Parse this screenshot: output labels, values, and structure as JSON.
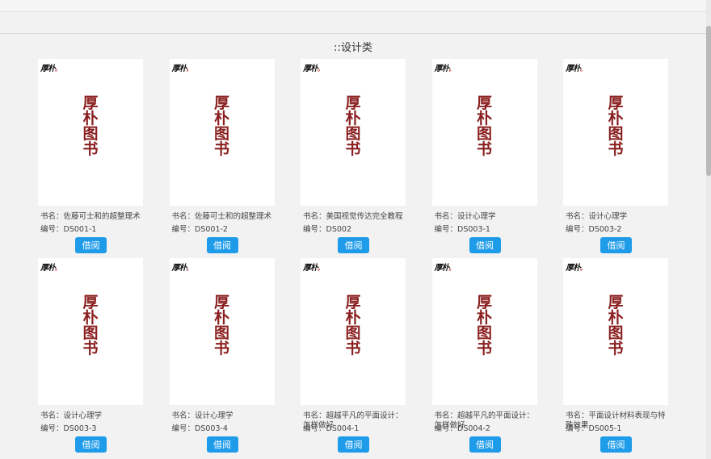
{
  "category": {
    "title": "::设计类"
  },
  "cover": {
    "logo": "厚朴",
    "logo_dot": "。",
    "title": "厚朴图书"
  },
  "labels": {
    "name_prefix": "书名：",
    "id_prefix": "编号：",
    "borrow": "借阅"
  },
  "books": [
    {
      "name": "佐藤可士和的超整理术",
      "id": "DS001-1"
    },
    {
      "name": "佐藤可士和的超整理术",
      "id": "DS001-2"
    },
    {
      "name": "美国视觉传达完全教程",
      "id": "DS002"
    },
    {
      "name": "设计心理学",
      "id": "DS003-1"
    },
    {
      "name": "设计心理学",
      "id": "DS003-2"
    },
    {
      "name": "设计心理学",
      "id": "DS003-3"
    },
    {
      "name": "设计心理学",
      "id": "DS003-4"
    },
    {
      "name": "超越平凡的平面设计：怎样做好",
      "id": "DS004-1"
    },
    {
      "name": "超越平凡的平面设计：怎样做好",
      "id": "DS004-2"
    },
    {
      "name": "平面设计材料表现与特殊效果",
      "id": "DS005-1"
    }
  ]
}
